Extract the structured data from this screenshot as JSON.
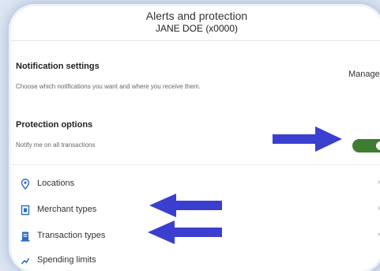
{
  "header": {
    "title": "Alerts and protection",
    "subtitle": "JANE DOE (x0000)"
  },
  "notification_settings": {
    "title": "Notification settings",
    "description": "Choose which notifications you want and where you receive them.",
    "manage_label": "Manage"
  },
  "protection_options": {
    "title": "Protection options",
    "toggle_label": "Notify me on all transactions",
    "toggle_on": true
  },
  "list": {
    "items": [
      {
        "label": "Locations",
        "icon": "location-pin-icon"
      },
      {
        "label": "Merchant types",
        "icon": "merchant-icon"
      },
      {
        "label": "Transaction types",
        "icon": "transaction-icon"
      },
      {
        "label": "Spending limits",
        "icon": "spending-limit-icon"
      }
    ]
  },
  "colors": {
    "accent": "#2a6cc7",
    "toggle_on": "#3d7d32",
    "annotation_arrow": "#3a3fcf"
  }
}
